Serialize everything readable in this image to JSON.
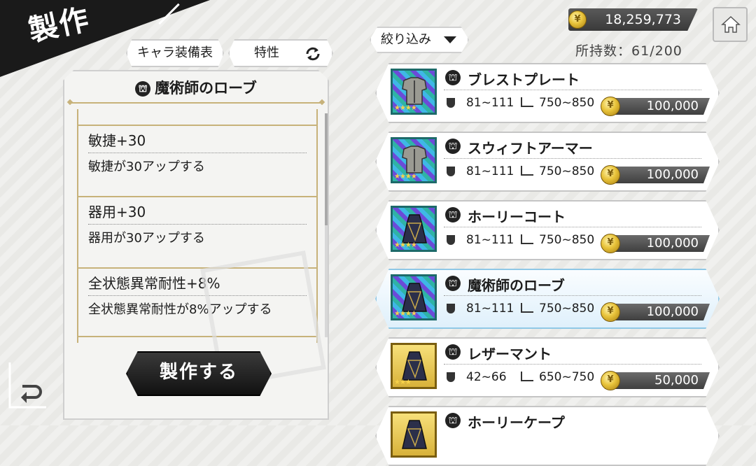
{
  "header": {
    "title": "製作"
  },
  "currency": {
    "amount": "18,259,773",
    "coin_symbol": "¥"
  },
  "owned": {
    "label": "所持数",
    "value": "61/200"
  },
  "filter": {
    "label": "絞り込み"
  },
  "tabs": {
    "chara_equip": "キャラ装備表",
    "traits": "特性"
  },
  "selected_item": {
    "name": "魔術師のローブ",
    "traits": [
      {
        "name": "敏捷+30",
        "desc": "敏捷が30アップする"
      },
      {
        "name": "器用+30",
        "desc": "器用が30アップする"
      },
      {
        "name": "全状態異常耐性+8%",
        "desc": "全状態異常耐性が8%アップする"
      }
    ]
  },
  "craft_button": {
    "label": "製作する"
  },
  "items": [
    {
      "name": "ブレストプレート",
      "def": "81~111",
      "weight": "750~850",
      "price": "100,000",
      "stars": "★★★★",
      "icon": "chest-armor",
      "frame": "rainbow",
      "selected": false
    },
    {
      "name": "スウィフトアーマー",
      "def": "81~111",
      "weight": "750~850",
      "price": "100,000",
      "stars": "★★★★",
      "icon": "chest-armor",
      "frame": "rainbow",
      "selected": false
    },
    {
      "name": "ホーリーコート",
      "def": "81~111",
      "weight": "750~850",
      "price": "100,000",
      "stars": "★★★★",
      "icon": "robe",
      "frame": "rainbow",
      "selected": false
    },
    {
      "name": "魔術師のローブ",
      "def": "81~111",
      "weight": "750~850",
      "price": "100,000",
      "stars": "★★★★",
      "icon": "robe",
      "frame": "rainbow",
      "selected": true
    },
    {
      "name": "レザーマント",
      "def": "42~66",
      "weight": "650~750",
      "price": "50,000",
      "stars": "★★★",
      "icon": "robe",
      "frame": "gold",
      "selected": false
    },
    {
      "name": "ホーリーケープ",
      "def": "",
      "weight": "",
      "price": "",
      "stars": "",
      "icon": "robe",
      "frame": "gold",
      "selected": false
    }
  ],
  "colors": {
    "accent_gold": "#c7b27a",
    "selected_blue": "#dff0fb",
    "dark": "#1a1a1a"
  }
}
